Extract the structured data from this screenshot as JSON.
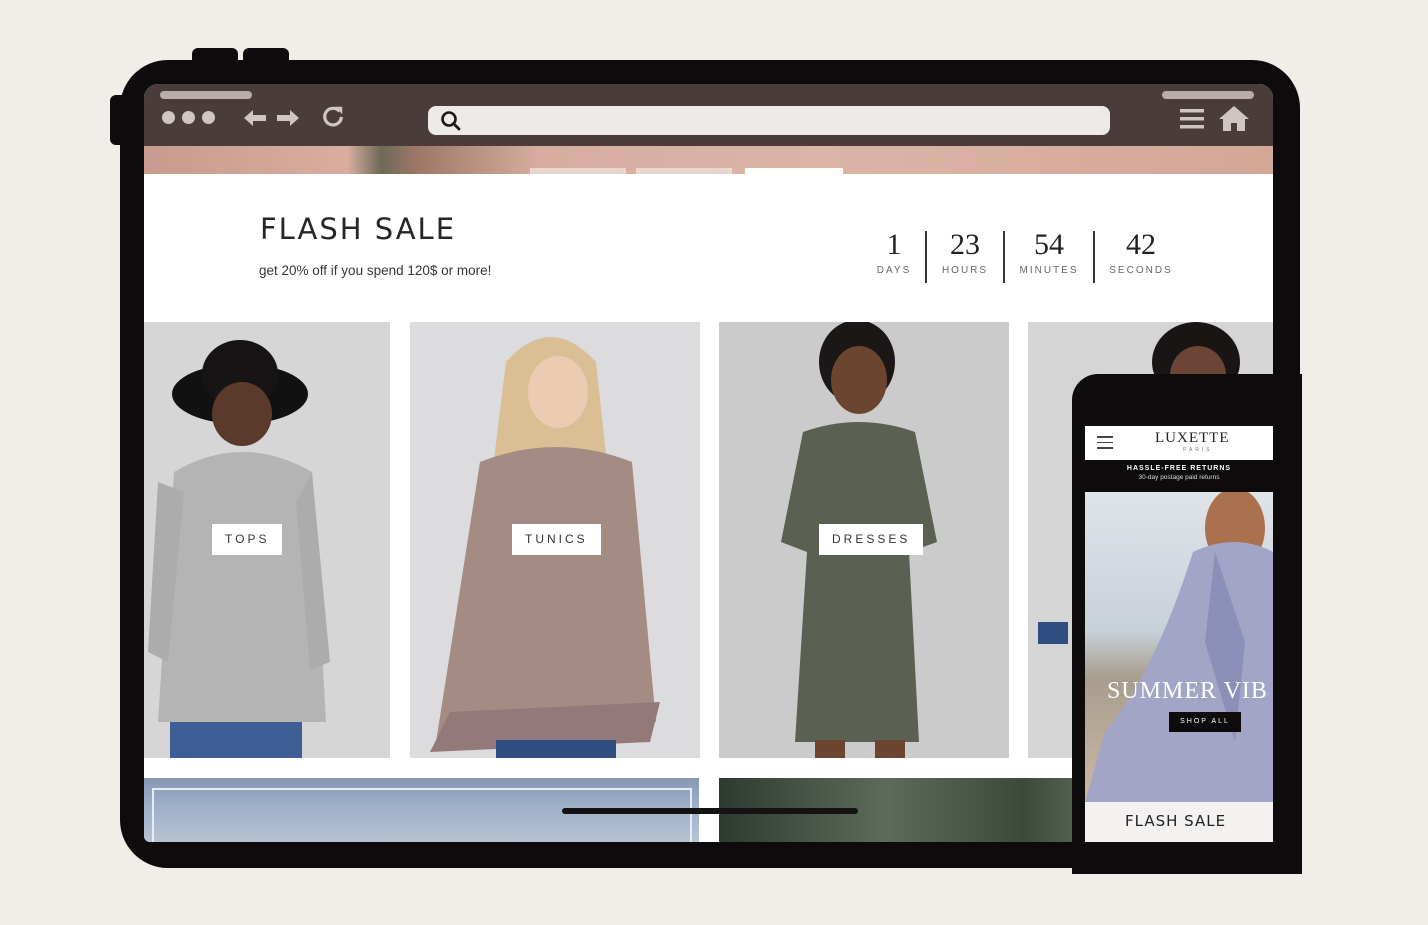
{
  "browser": {
    "url_value": "",
    "icons": [
      "window-dots-icon",
      "back-arrow-icon",
      "forward-arrow-icon",
      "reload-icon",
      "search-icon",
      "menu-icon",
      "home-icon"
    ]
  },
  "flash_sale": {
    "title": "FLASH SALE",
    "subtitle": "get 20% off if you spend 120$ or more!",
    "countdown": [
      {
        "value": "1",
        "label": "DAYS"
      },
      {
        "value": "23",
        "label": "HOURS"
      },
      {
        "value": "54",
        "label": "MINUTES"
      },
      {
        "value": "42",
        "label": "SECONDS"
      }
    ]
  },
  "categories": [
    {
      "label": "TOPS"
    },
    {
      "label": "TUNICS"
    },
    {
      "label": "DRESSES"
    }
  ],
  "phone": {
    "logo": "LUXETTE",
    "logo_sub": "PARIS",
    "notice_title": "HASSLE-FREE RETURNS",
    "notice_sub": "30-day postage paid returns",
    "hero_title": "SUMMER VIB",
    "shop_button": "SHOP ALL",
    "flash_title": "FLASH SALE"
  },
  "colors": {
    "background": "#f1ede9",
    "frame": "#0d0b0b",
    "browser_bar": "#4a3c3b",
    "url_bar": "#eeeae9"
  }
}
